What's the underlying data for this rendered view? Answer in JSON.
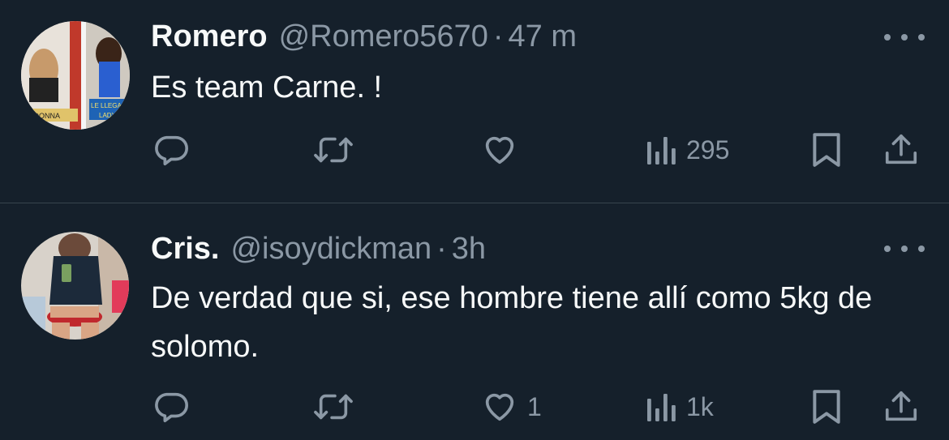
{
  "tweets": [
    {
      "name": "Romero",
      "handle": "@Romero5670",
      "separator": "·",
      "time": "47 m",
      "text": "Es team Carne. !",
      "avatar_texts": [
        "MADONNA",
        "LE LLEGA",
        "LADY"
      ],
      "likes": "",
      "views": "295"
    },
    {
      "name": "Cris.",
      "handle": "@isoydickman",
      "separator": "·",
      "time": "3h",
      "text": "De verdad que si, ese hombre tiene allí como 5kg de solomo.",
      "likes": "1",
      "views": "1k"
    }
  ],
  "icons": {
    "reply": "reply-icon",
    "retweet": "retweet-icon",
    "like": "heart-icon",
    "views": "views-icon",
    "bookmark": "bookmark-icon",
    "share": "share-icon",
    "more": "more-icon"
  },
  "colors": {
    "background": "#15202b",
    "text": "#f7f9f9",
    "muted": "#8b98a5",
    "divider": "#38444d"
  }
}
